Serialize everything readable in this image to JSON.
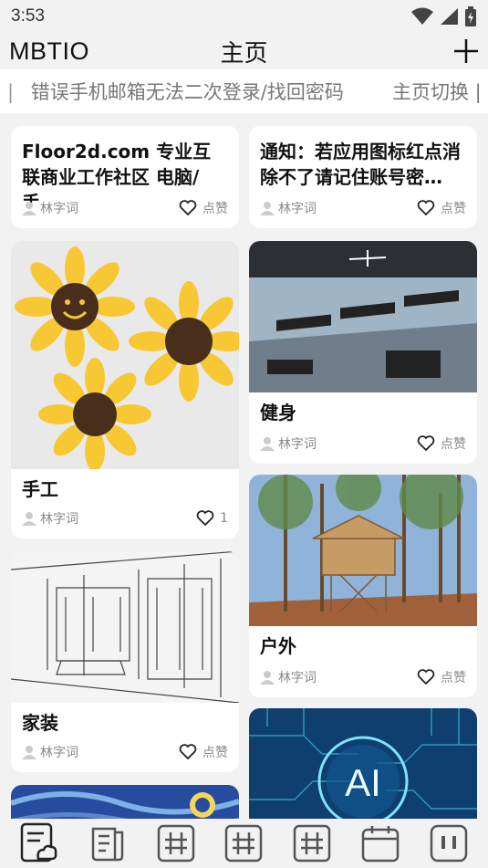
{
  "status": {
    "time": "3:53"
  },
  "appbar": {
    "brand": "MBTIO",
    "title": "主页",
    "add_label": "+"
  },
  "marquee": {
    "sep": "|",
    "message": "错误手机邮箱无法二次登录/找回密码",
    "message2": "主页切换 |"
  },
  "cards": [
    {
      "title": "Floor2d.com 专业互联商业工作社区 电脑/手…",
      "author": "林字词",
      "likes": "点赞"
    },
    {
      "title": "通知：若应用图标红点消除不了请记住账号密…",
      "author": "林字词",
      "likes": "点赞"
    },
    {
      "title": "手工",
      "author": "林字词",
      "likes": "1"
    },
    {
      "title": "健身",
      "author": "林字词",
      "likes": "点赞"
    },
    {
      "title": "家装",
      "author": "林字词",
      "likes": "点赞"
    },
    {
      "title": "户外",
      "author": "林字词",
      "likes": "点赞"
    }
  ],
  "ai_label": "AI",
  "tabs": [
    {
      "name": "notes-cloud-icon"
    },
    {
      "name": "documents-icon"
    },
    {
      "name": "frame-icon-1"
    },
    {
      "name": "frame-icon-2"
    },
    {
      "name": "frame-icon-3"
    },
    {
      "name": "calendar-icon"
    },
    {
      "name": "pause-box-icon"
    }
  ]
}
